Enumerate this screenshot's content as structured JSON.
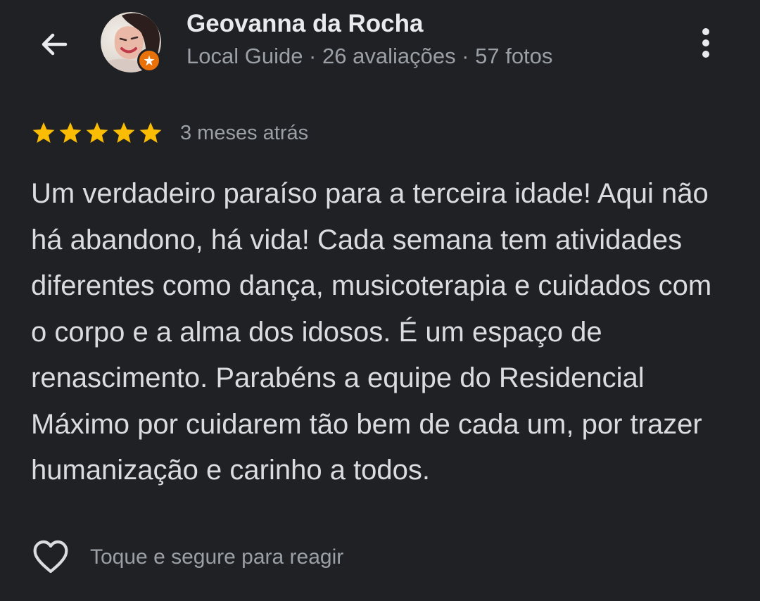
{
  "header": {
    "back_icon": "arrow-back-icon",
    "more_icon": "more-vert-icon"
  },
  "reviewer": {
    "name": "Geovanna da Rocha",
    "meta": "Local Guide · 26 avaliações · 57 fotos",
    "badge_icon": "local-guide-star-icon",
    "badge_color": "#e8710a"
  },
  "review": {
    "rating": 5,
    "rating_max": 5,
    "star_color": "#fbbc04",
    "date": "3 meses atrás",
    "text": "Um verdadeiro paraíso para a terceira idade! Aqui não há abandono, há vida! Cada semana tem atividades diferentes como dança, musicoterapia e cuidados com o corpo e a alma dos idosos. É um espaço de renascimento. Parabéns a equipe do Residencial Máximo por cuidarem tão bem de cada um, por trazer humanização e carinho a todos."
  },
  "reaction": {
    "icon": "heart-outline-icon",
    "label": "Toque e segure para reagir"
  },
  "colors": {
    "background": "#202124",
    "primary_text": "#e8eaed",
    "secondary_text": "#9aa0a6"
  }
}
